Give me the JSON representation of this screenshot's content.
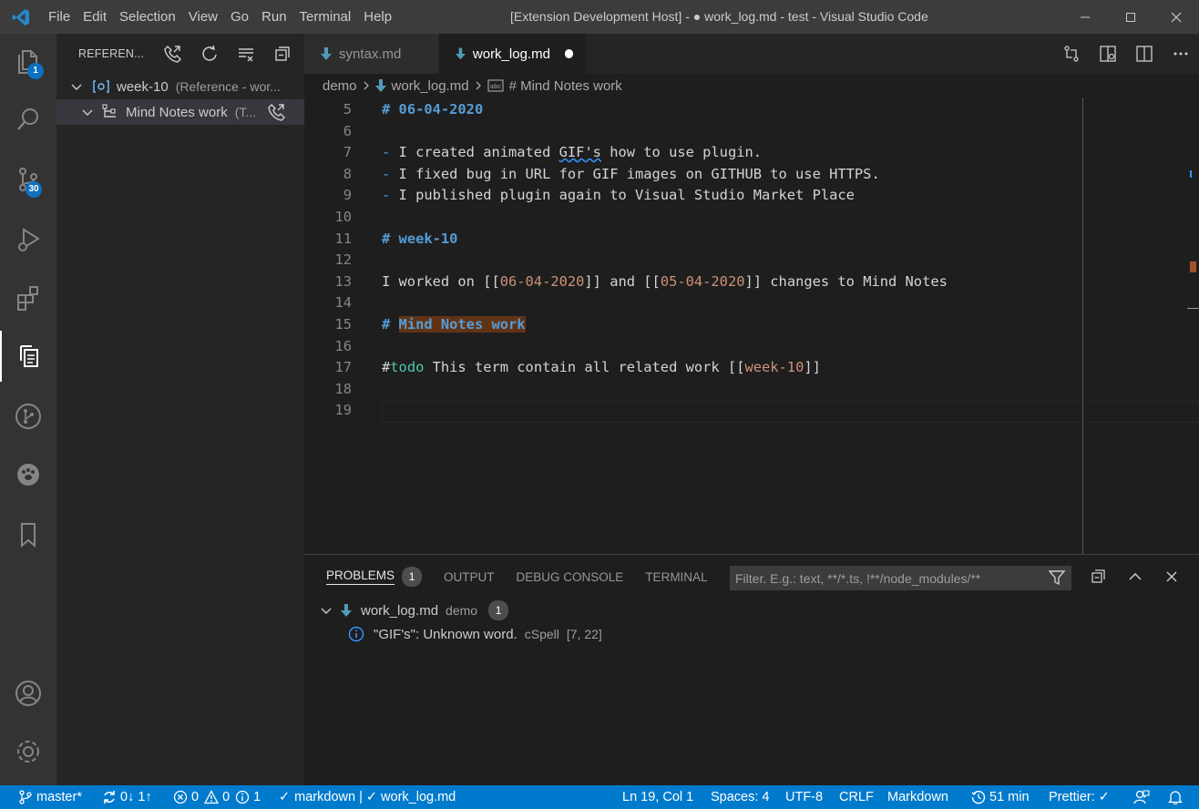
{
  "titlebar": {
    "menu": [
      "File",
      "Edit",
      "Selection",
      "View",
      "Go",
      "Run",
      "Terminal",
      "Help"
    ],
    "title": "[Extension Development Host] - ● work_log.md - test - Visual Studio Code"
  },
  "activitybar": {
    "explorer_badge": "1",
    "scm_badge": "30"
  },
  "sidebar": {
    "title": "REFEREN...",
    "tree": [
      {
        "label": "week-10",
        "description": "(Reference - wor..."
      },
      {
        "label": "Mind Notes work",
        "description": "(T..."
      }
    ]
  },
  "tabs": [
    {
      "label": "syntax.md"
    },
    {
      "label": "work_log.md"
    }
  ],
  "breadcrumb": {
    "folder": "demo",
    "file": "work_log.md",
    "symbol": "# Mind Notes work"
  },
  "editor": {
    "lines": [
      {
        "num": "5",
        "parts": [
          {
            "t": "# ",
            "c": "h"
          },
          {
            "t": "06-04-2020",
            "c": "h"
          }
        ]
      },
      {
        "num": "6",
        "parts": []
      },
      {
        "num": "7",
        "parts": [
          {
            "t": "- ",
            "c": "h-dash"
          },
          {
            "t": "I created animated ",
            "c": ""
          },
          {
            "t": "GIF's",
            "c": "sq"
          },
          {
            "t": " how to use plugin.",
            "c": ""
          }
        ]
      },
      {
        "num": "8",
        "parts": [
          {
            "t": "- ",
            "c": "h-dash"
          },
          {
            "t": "I fixed bug in URL for GIF images on GITHUB to use HTTPS.",
            "c": ""
          }
        ]
      },
      {
        "num": "9",
        "parts": [
          {
            "t": "- ",
            "c": "h-dash"
          },
          {
            "t": "I published plugin again to Visual Studio Market Place",
            "c": ""
          }
        ]
      },
      {
        "num": "10",
        "parts": []
      },
      {
        "num": "11",
        "parts": [
          {
            "t": "# ",
            "c": "h"
          },
          {
            "t": "week-10",
            "c": "h"
          }
        ]
      },
      {
        "num": "12",
        "parts": []
      },
      {
        "num": "13",
        "parts": [
          {
            "t": "I worked on [[",
            "c": ""
          },
          {
            "t": "06-04-2020",
            "c": "lk"
          },
          {
            "t": "]] and [[",
            "c": ""
          },
          {
            "t": "05-04-2020",
            "c": "lk"
          },
          {
            "t": "]] changes to Mind Notes",
            "c": ""
          }
        ]
      },
      {
        "num": "14",
        "parts": []
      },
      {
        "num": "15",
        "parts": [
          {
            "t": "# ",
            "c": "h"
          },
          {
            "t": "Mind Notes work",
            "c": "h hl"
          }
        ]
      },
      {
        "num": "16",
        "parts": []
      },
      {
        "num": "17",
        "parts": [
          {
            "t": "#",
            "c": ""
          },
          {
            "t": "todo",
            "c": "tag"
          },
          {
            "t": " This term contain all related work [[",
            "c": ""
          },
          {
            "t": "week-10",
            "c": "lk"
          },
          {
            "t": "]]",
            "c": ""
          }
        ]
      },
      {
        "num": "18",
        "parts": []
      },
      {
        "num": "19",
        "parts": []
      }
    ]
  },
  "panel": {
    "tabs": [
      "PROBLEMS",
      "OUTPUT",
      "DEBUG CONSOLE",
      "TERMINAL"
    ],
    "problems_count": "1",
    "filter_placeholder": "Filter. E.g.: text, **/*.ts, !**/node_modules/**",
    "file": {
      "name": "work_log.md",
      "folder": "demo",
      "count": "1"
    },
    "problem": {
      "message": "\"GIF's\": Unknown word.",
      "source": "cSpell",
      "location": "[7, 22]"
    }
  },
  "statusbar": {
    "branch": "master*",
    "sync": "0↓ 1↑",
    "errors": "0",
    "warnings": "0",
    "infos": "1",
    "lang_check": "markdown | ✓ work_log.md",
    "position": "Ln 19, Col 1",
    "spaces": "Spaces: 4",
    "encoding": "UTF-8",
    "eol": "CRLF",
    "language": "Markdown",
    "timer": "51 min",
    "prettier": "Prettier: ✓"
  },
  "colors": {
    "accent": "#007acc",
    "heading": "#569cd6",
    "link": "#ce9178",
    "tag": "#4ec9b0",
    "highlight": "#613315"
  }
}
